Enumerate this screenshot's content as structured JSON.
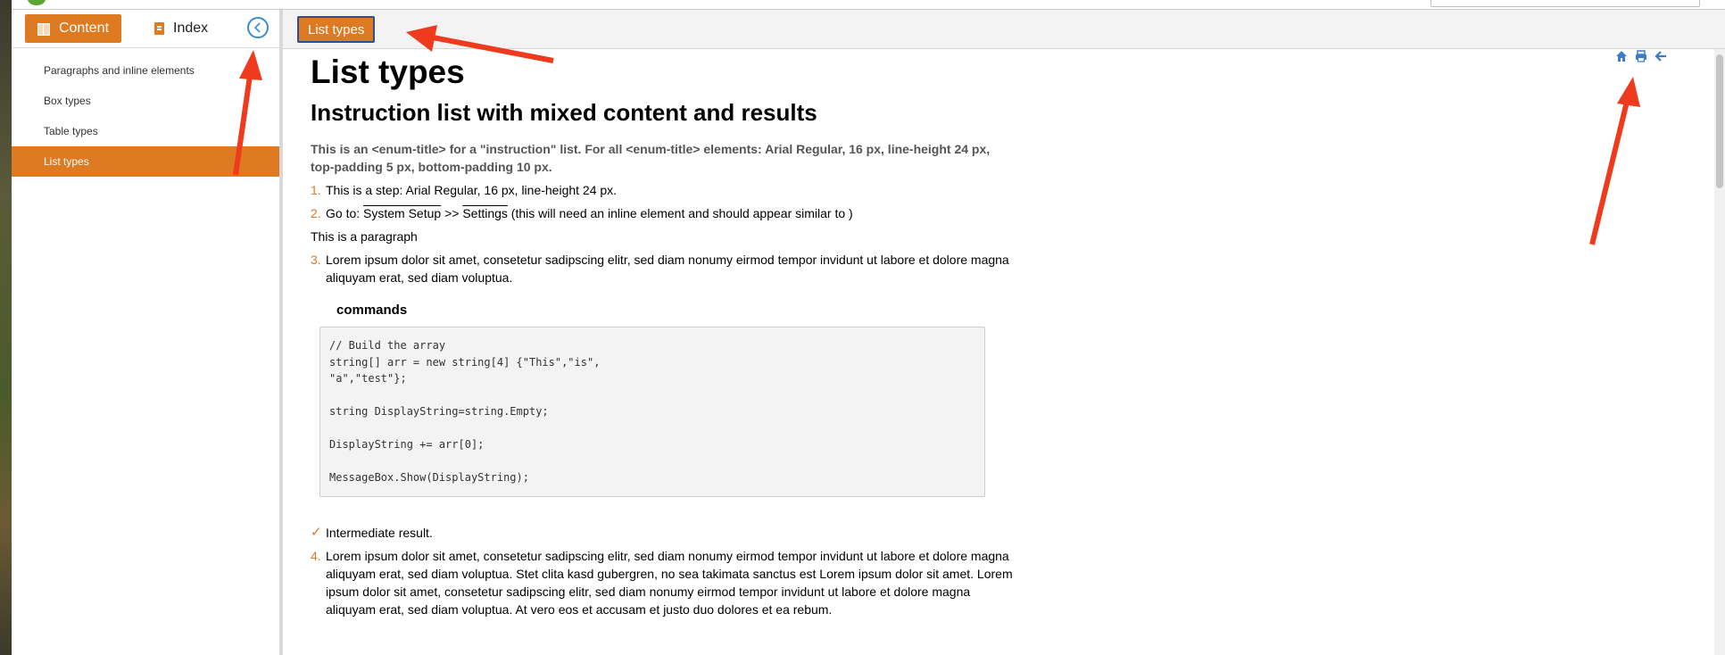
{
  "colors": {
    "accent": "#de7a22",
    "link_blue": "#3a8cd0",
    "annotation_red": "#f03a1e"
  },
  "sidebar": {
    "tabs": [
      {
        "label": "Content",
        "icon": "book-icon"
      },
      {
        "label": "Index",
        "icon": "index-icon"
      }
    ],
    "collapse_icon": "chevron-left-circle-icon",
    "items": [
      {
        "label": "Paragraphs and inline elements",
        "active": false
      },
      {
        "label": "Box types",
        "active": false
      },
      {
        "label": "Table types",
        "active": false
      },
      {
        "label": "List types",
        "active": true
      }
    ]
  },
  "breadcrumb": {
    "current": "List types"
  },
  "toolbar": {
    "icons": [
      "home-icon",
      "print-icon",
      "back-arrow-icon"
    ]
  },
  "content": {
    "title": "List types",
    "section_title": "Instruction list with mixed content and results",
    "enum_title": "This is an <enum-title> for a \"instruction\" list. For all <enum-title> elements: Arial Regular, 16 px, line-height 24 px, top-padding 5 px, bottom-padding 10 px.",
    "step1": {
      "num": "1.",
      "text": "This is a step: Arial Regular, 16 px, line-height 24 px."
    },
    "step2": {
      "num": "2.",
      "prefix": "Go to: ",
      "link1": "System Setup",
      "sep": " >> ",
      "link2": "Settings",
      "suffix": " (this will need an inline element and should appear similar to )"
    },
    "paragraph": "This is a paragraph",
    "step3": {
      "num": "3.",
      "text": "Lorem ipsum dolor sit amet, consetetur sadipscing elitr, sed diam nonumy eirmod tempor invidunt ut labore et dolore magna aliquyam erat, sed diam voluptua."
    },
    "commands_label": "commands",
    "code": "// Build the array\nstring[] arr = new string[4] {\"This\",\"is\",\n\"a\",\"test\"};\n\nstring DisplayString=string.Empty;\n\nDisplayString += arr[0];\n\nMessageBox.Show(DisplayString);",
    "result": {
      "mark": "✓",
      "text": "Intermediate result."
    },
    "step4": {
      "num": "4.",
      "text": "Lorem ipsum dolor sit amet, consetetur sadipscing elitr, sed diam nonumy eirmod tempor invidunt ut labore et dolore magna aliquyam erat, sed diam voluptua. Stet clita kasd gubergren, no sea takimata sanctus est Lorem ipsum dolor sit amet. Lorem ipsum dolor sit amet, consetetur sadipscing elitr, sed diam nonumy eirmod tempor invidunt ut labore et dolore magna aliquyam erat, sed diam voluptua. At vero eos et accusam et justo duo dolores et ea rebum."
    }
  }
}
